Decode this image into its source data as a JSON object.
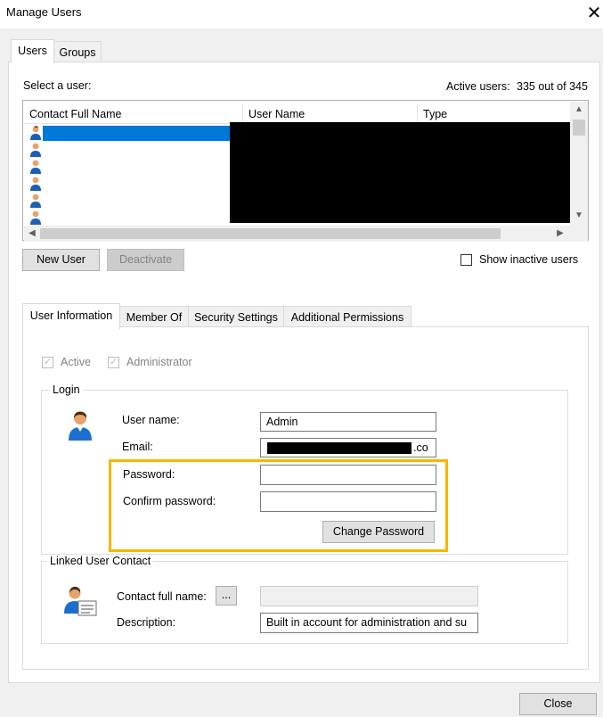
{
  "window": {
    "title": "Manage Users"
  },
  "top_tabs": [
    "Users",
    "Groups"
  ],
  "users_panel": {
    "select_label": "Select a user:",
    "active_users_label": "Active users:",
    "active_users_count": "335 out of 345",
    "columns": [
      "Contact Full Name",
      "User Name",
      "Type"
    ],
    "row_count": 6,
    "buttons": {
      "new_user": "New User",
      "deactivate": "Deactivate"
    },
    "show_inactive_label": "Show inactive users"
  },
  "detail_tabs": [
    "User Information",
    "Member Of",
    "Security Settings",
    "Additional Permissions"
  ],
  "user_info": {
    "active_label": "Active",
    "administrator_label": "Administrator",
    "login_group": "Login",
    "user_name_label": "User name:",
    "user_name_value": "Admin",
    "email_label": "Email:",
    "email_suffix": ".co",
    "password_label": "Password:",
    "confirm_password_label": "Confirm password:",
    "change_password_button": "Change Password",
    "linked_group": "Linked User Contact",
    "contact_full_name_label": "Contact full name:",
    "ellipsis_button": "...",
    "description_label": "Description:",
    "description_value": "Built in account for administration and su"
  },
  "footer": {
    "close_button": "Close"
  },
  "colors": {
    "highlight": "#f5b700",
    "selection": "#0078d7"
  }
}
